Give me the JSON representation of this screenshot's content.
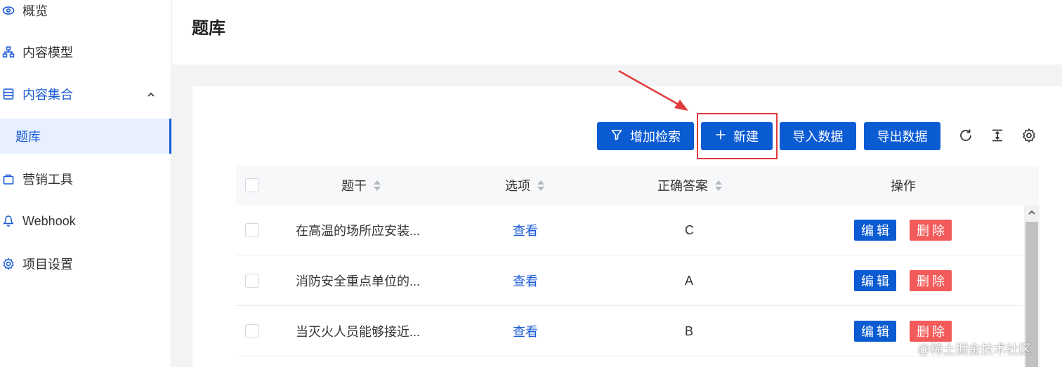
{
  "sidebar": {
    "items": [
      {
        "label": "概览",
        "icon": "eye-icon"
      },
      {
        "label": "内容模型",
        "icon": "sitemap-icon"
      },
      {
        "label": "内容集合",
        "icon": "database-icon"
      },
      {
        "label": "题库",
        "icon": ""
      },
      {
        "label": "营销工具",
        "icon": "bag-icon"
      },
      {
        "label": "Webhook",
        "icon": "webhook-icon"
      },
      {
        "label": "项目设置",
        "icon": "gear-icon"
      }
    ]
  },
  "header": {
    "title": "题库"
  },
  "toolbar": {
    "add_filter": "增加检索",
    "new": "新建",
    "import": "导入数据",
    "export": "导出数据",
    "icons": [
      "refresh-icon",
      "column-height-icon",
      "settings-icon"
    ]
  },
  "table": {
    "columns": [
      "题干",
      "选项",
      "正确答案",
      "操作"
    ],
    "rows": [
      {
        "stem": "在高温的场所应安装...",
        "options": "查看",
        "answer": "C",
        "edit": "编辑",
        "delete": "删除"
      },
      {
        "stem": "消防安全重点单位的...",
        "options": "查看",
        "answer": "A",
        "edit": "编辑",
        "delete": "删除"
      },
      {
        "stem": "当灭火人员能够接近...",
        "options": "查看",
        "answer": "B",
        "edit": "编辑",
        "delete": "删除"
      }
    ]
  },
  "watermark": "@稀土掘金技术社区",
  "colors": {
    "primary": "#0b5bd3",
    "danger": "#f35a5a",
    "highlight": "#e03a3a",
    "active_bg": "#e8f0fd"
  }
}
